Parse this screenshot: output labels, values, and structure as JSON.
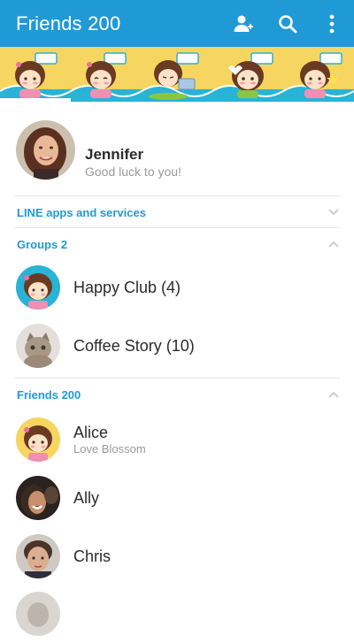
{
  "app_bar": {
    "title": "Friends 200",
    "add_friend_icon": "add-friend-icon",
    "search_icon": "search-icon",
    "menu_icon": "more-vertical-icon",
    "color": "#1f9ad6"
  },
  "profile": {
    "name": "Jennifer",
    "status": "Good luck to you!"
  },
  "sections": {
    "apps": {
      "label": "LINE apps and services",
      "chevron": "chevron-down-icon"
    },
    "groups": {
      "label": "Groups 2",
      "chevron": "chevron-up-icon"
    },
    "friends": {
      "label": "Friends 200",
      "chevron": "chevron-up-icon"
    }
  },
  "groups": [
    {
      "name": "Happy Club (4)"
    },
    {
      "name": "Coffee Story (10)"
    }
  ],
  "friends": [
    {
      "name": "Alice",
      "status": "Love Blossom"
    },
    {
      "name": "Ally"
    },
    {
      "name": "Chris"
    }
  ]
}
